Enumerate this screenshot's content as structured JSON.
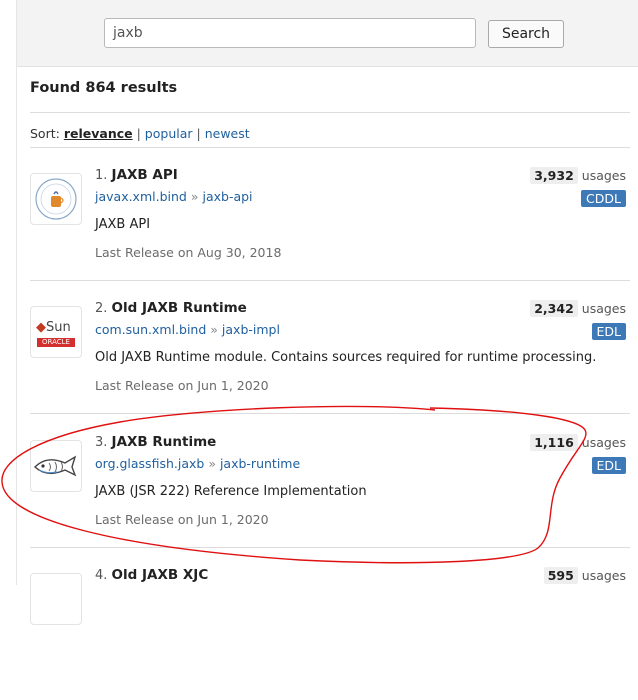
{
  "search": {
    "value": "jaxb",
    "button_label": "Search"
  },
  "results_header": "Found 864 results",
  "sort": {
    "label": "Sort:",
    "options": [
      "relevance",
      "popular",
      "newest"
    ],
    "separator": "|"
  },
  "results": [
    {
      "index": "1.",
      "name": "JAXB API",
      "group": "javax.xml.bind",
      "artifact": "jaxb-api",
      "arrow": "»",
      "description": "JAXB API",
      "last_release": "Last Release on Aug 30, 2018",
      "usage_count": "3,932",
      "usage_label": "usages",
      "license": "CDDL",
      "logo": "jcp-logo"
    },
    {
      "index": "2.",
      "name": "Old JAXB Runtime",
      "group": "com.sun.xml.bind",
      "artifact": "jaxb-impl",
      "arrow": "»",
      "description": "Old JAXB Runtime module. Contains sources required for runtime processing.",
      "last_release": "Last Release on Jun 1, 2020",
      "usage_count": "2,342",
      "usage_label": "usages",
      "license": "EDL",
      "logo": "sun-oracle-logo",
      "logo_text": {
        "top": "Sun",
        "bottom": "ORACLE"
      }
    },
    {
      "index": "3.",
      "name": "JAXB Runtime",
      "group": "org.glassfish.jaxb",
      "artifact": "jaxb-runtime",
      "arrow": "»",
      "description": "JAXB (JSR 222) Reference Implementation",
      "last_release": "Last Release on Jun 1, 2020",
      "usage_count": "1,116",
      "usage_label": "usages",
      "license": "EDL",
      "logo": "glassfish-logo"
    },
    {
      "index": "4.",
      "name": "Old JAXB XJC",
      "usage_count": "595",
      "usage_label": "usages",
      "logo": "sun-oracle-logo"
    }
  ],
  "colors": {
    "link": "#1f5f9e",
    "license_badge": "#3d79b7",
    "annotation": "#e01010",
    "search_bar_bg": "#f3f3f3"
  }
}
